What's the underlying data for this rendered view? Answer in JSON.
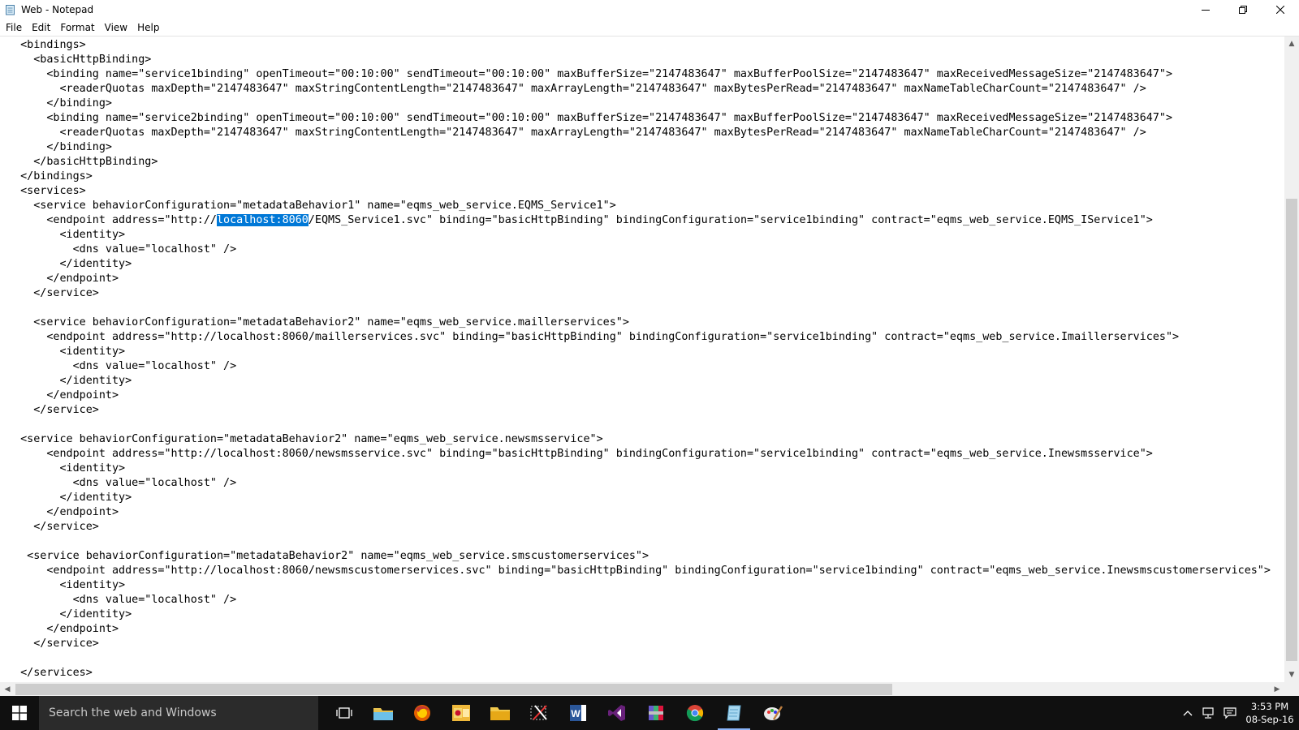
{
  "window": {
    "title": "Web - Notepad"
  },
  "menu": [
    "File",
    "Edit",
    "Format",
    "View",
    "Help"
  ],
  "editor": {
    "lines": [
      "  <bindings>",
      "    <basicHttpBinding>",
      "      <binding name=\"service1binding\" openTimeout=\"00:10:00\" sendTimeout=\"00:10:00\" maxBufferSize=\"2147483647\" maxBufferPoolSize=\"2147483647\" maxReceivedMessageSize=\"2147483647\">",
      "        <readerQuotas maxDepth=\"2147483647\" maxStringContentLength=\"2147483647\" maxArrayLength=\"2147483647\" maxBytesPerRead=\"2147483647\" maxNameTableCharCount=\"2147483647\" />",
      "      </binding>",
      "      <binding name=\"service2binding\" openTimeout=\"00:10:00\" sendTimeout=\"00:10:00\" maxBufferSize=\"2147483647\" maxBufferPoolSize=\"2147483647\" maxReceivedMessageSize=\"2147483647\">",
      "        <readerQuotas maxDepth=\"2147483647\" maxStringContentLength=\"2147483647\" maxArrayLength=\"2147483647\" maxBytesPerRead=\"2147483647\" maxNameTableCharCount=\"2147483647\" />",
      "      </binding>",
      "    </basicHttpBinding>",
      "  </bindings>",
      "  <services>",
      "    <service behaviorConfiguration=\"metadataBehavior1\" name=\"eqms_web_service.EQMS_Service1\">",
      "      <endpoint address=\"http://localhost:8060/EQMS_Service1.svc\" binding=\"basicHttpBinding\" bindingConfiguration=\"service1binding\" contract=\"eqms_web_service.EQMS_IService1\">",
      "        <identity>",
      "          <dns value=\"localhost\" />",
      "        </identity>",
      "      </endpoint>",
      "    </service>",
      "",
      "    <service behaviorConfiguration=\"metadataBehavior2\" name=\"eqms_web_service.maillerservices\">",
      "      <endpoint address=\"http://localhost:8060/maillerservices.svc\" binding=\"basicHttpBinding\" bindingConfiguration=\"service1binding\" contract=\"eqms_web_service.Imaillerservices\">",
      "        <identity>",
      "          <dns value=\"localhost\" />",
      "        </identity>",
      "      </endpoint>",
      "    </service>",
      "",
      "  <service behaviorConfiguration=\"metadataBehavior2\" name=\"eqms_web_service.newsmsservice\">",
      "      <endpoint address=\"http://localhost:8060/newsmsservice.svc\" binding=\"basicHttpBinding\" bindingConfiguration=\"service1binding\" contract=\"eqms_web_service.Inewsmsservice\">",
      "        <identity>",
      "          <dns value=\"localhost\" />",
      "        </identity>",
      "      </endpoint>",
      "    </service>",
      "",
      "   <service behaviorConfiguration=\"metadataBehavior2\" name=\"eqms_web_service.smscustomerservices\">",
      "      <endpoint address=\"http://localhost:8060/newsmscustomerservices.svc\" binding=\"basicHttpBinding\" bindingConfiguration=\"service1binding\" contract=\"eqms_web_service.Inewsmscustomerservices\">",
      "        <identity>",
      "          <dns value=\"localhost\" />",
      "        </identity>",
      "      </endpoint>",
      "    </service>",
      "",
      "  </services>"
    ],
    "selection": {
      "line": 12,
      "text": "localhost:8060"
    },
    "selection_color": "#0078d7"
  },
  "taskbar": {
    "search_placeholder": "Search the web and Windows",
    "apps": [
      "task-view-icon",
      "file-explorer-icon",
      "firefox-icon",
      "outlook-icon",
      "folder-icon",
      "snipping-tool-icon",
      "word-icon",
      "visual-studio-icon",
      "archive-icon",
      "chrome-icon",
      "notepad-icon",
      "paint-icon"
    ],
    "clock": {
      "time": "3:53 PM",
      "date": "08-Sep-16"
    }
  }
}
